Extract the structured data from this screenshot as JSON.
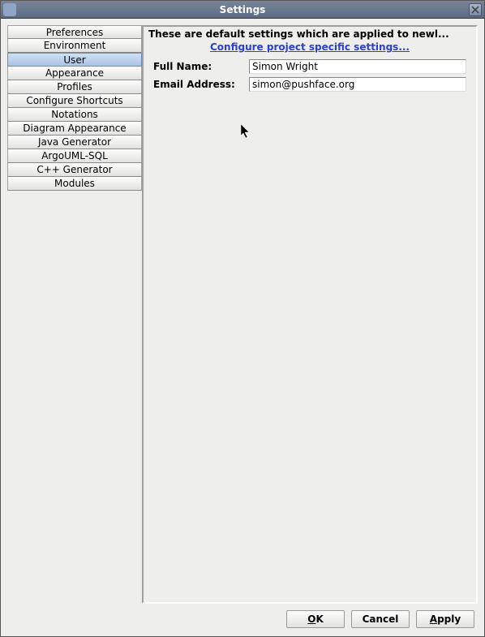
{
  "window": {
    "title": "Settings"
  },
  "sidebar": {
    "items": [
      {
        "label": "Preferences"
      },
      {
        "label": "Environment"
      },
      {
        "label": "User",
        "selected": true
      },
      {
        "label": "Appearance"
      },
      {
        "label": "Profiles"
      },
      {
        "label": "Configure Shortcuts"
      },
      {
        "label": "Notations"
      },
      {
        "label": "Diagram Appearance"
      },
      {
        "label": "Java Generator"
      },
      {
        "label": "ArgoUML-SQL"
      },
      {
        "label": "C++ Generator"
      },
      {
        "label": "Modules"
      }
    ]
  },
  "content": {
    "description": "These are default settings which are applied to newl...",
    "link": "Configure project specific settings...",
    "form": {
      "fullname_label": "Full Name:",
      "fullname_value": "Simon Wright",
      "email_label": "Email Address:",
      "email_value": "simon@pushface.org"
    }
  },
  "buttons": {
    "ok": "OK",
    "cancel": "Cancel",
    "apply": "Apply"
  }
}
